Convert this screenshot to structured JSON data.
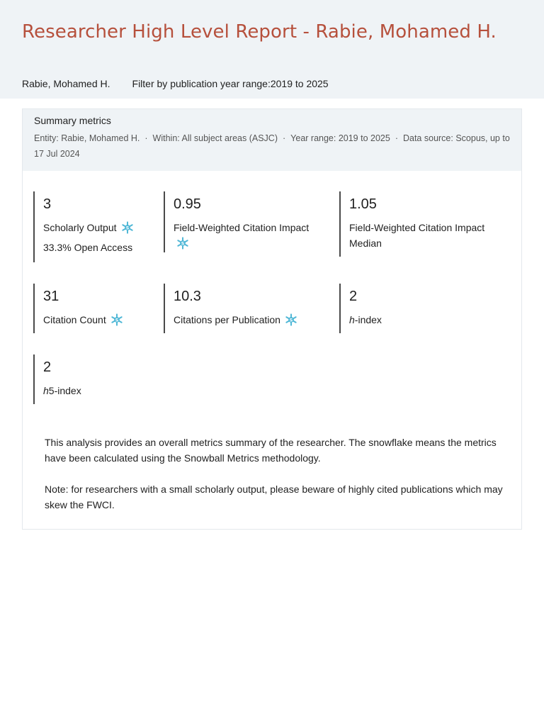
{
  "header": {
    "title": "Researcher High Level Report - Rabie, Mohamed H.",
    "entity": "Rabie, Mohamed H.",
    "filter_prefix": "Filter by publication year range:",
    "filter_value": "2019 to 2025"
  },
  "summary": {
    "title": "Summary metrics",
    "entity": "Entity: Rabie, Mohamed H.",
    "within": "Within: All subject areas (ASJC)",
    "year_range": "Year range: 2019 to 2025",
    "source": "Data source: Scopus, up to 17 Jul 2024",
    "separator": "·"
  },
  "metrics": {
    "scholarly_output": {
      "value": "3",
      "label": "Scholarly Output",
      "sub": "33.3% Open Access",
      "icon": "snowflake-icon"
    },
    "fwci": {
      "value": "0.95",
      "label": "Field-Weighted Citation Impact",
      "icon": "snowflake-icon"
    },
    "fwci_median": {
      "value": "1.05",
      "label": "Field-Weighted Citation Impact Median"
    },
    "citation_count": {
      "value": "31",
      "label": "Citation Count",
      "icon": "snowflake-icon"
    },
    "citations_per_pub": {
      "value": "10.3",
      "label": "Citations per Publication",
      "icon": "snowflake-icon"
    },
    "h_index": {
      "value": "2",
      "label_italic": "h",
      "label_rest": "-index"
    },
    "h5_index": {
      "value": "2",
      "label_italic": "h",
      "label_rest": "5-index"
    }
  },
  "notes": {
    "p1": "This analysis provides an overall metrics summary of the researcher. The snowflake means the metrics have been calculated using the Snowball Metrics methodology.",
    "p2": "Note: for researchers with a small scholarly output, please beware of highly cited publications which may skew the FWCI."
  },
  "colors": {
    "title": "#b6503c",
    "header_bg": "#eff3f6",
    "snowflake": "#4fb7d6"
  }
}
